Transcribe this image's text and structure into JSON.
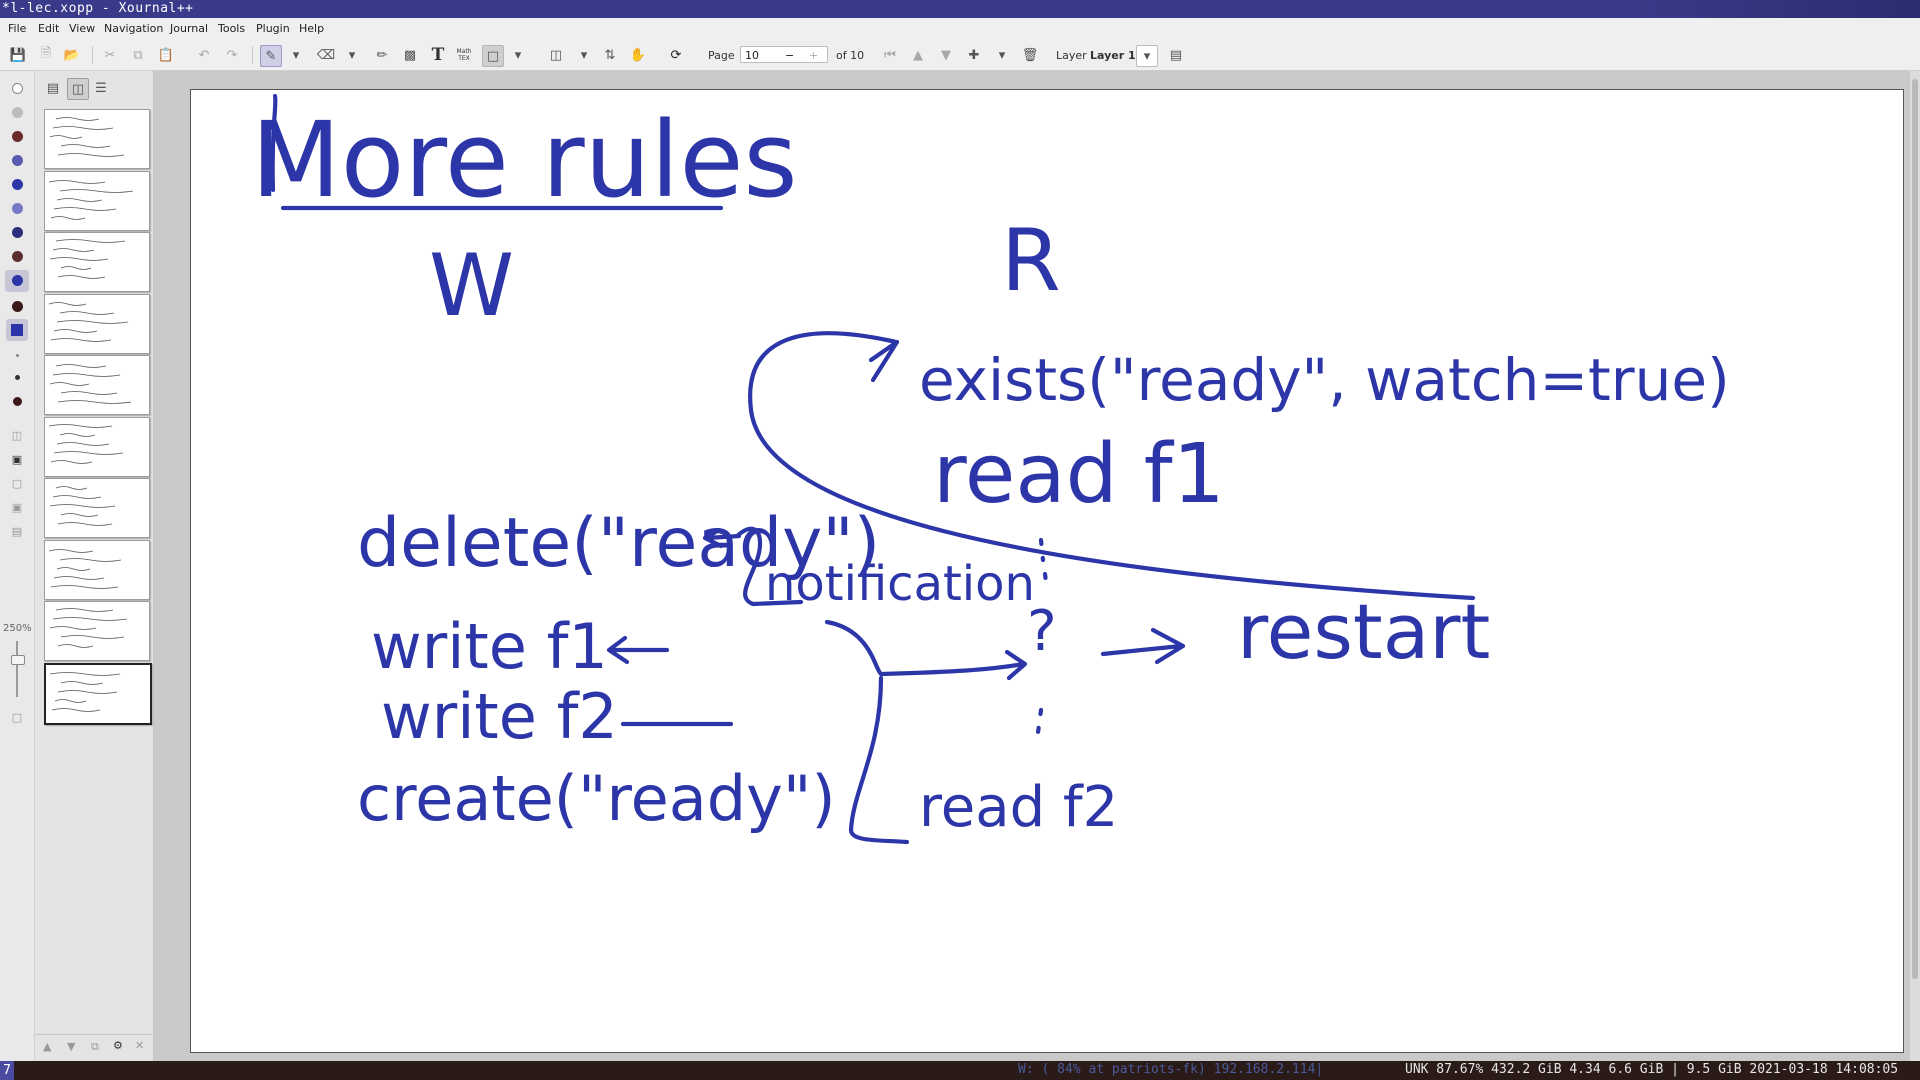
{
  "window": {
    "title": "*l-lec.xopp - Xournal++"
  },
  "menu": [
    "File",
    "Edit",
    "View",
    "Navigation",
    "Journal",
    "Tools",
    "Plugin",
    "Help"
  ],
  "toolbar": {
    "page_label": "Page",
    "page_value": "10",
    "page_of": "of 10",
    "layer_label": "Layer",
    "layer_value": "Layer 1",
    "math_label": "Math\nTEX"
  },
  "left_strip": {
    "zoom": "250%"
  },
  "sidebar": {
    "pages": 10,
    "selected_page": 10
  },
  "status": {
    "workspace": "7",
    "network": "W: ( 84% at patriots-fk) 192.168.2.114|",
    "system": "UNK 87.67% 432.2 GiB 4.34 6.6 GiB | 9.5 GiB 2021-03-18 14:08:05"
  },
  "note": {
    "title": "More rules",
    "writer_header": "W",
    "reader_header": "R",
    "writer_steps": [
      "delete(\"ready\")",
      "write f1",
      "write f2",
      "create(\"ready\")"
    ],
    "notification": "notification",
    "reader_exists": "exists(\"ready\", watch=true)",
    "reader_read1": "read f1",
    "question": "?",
    "restart": "restart",
    "reader_read2": "read f2"
  },
  "colors": {
    "ink": "#2c36a8",
    "titlebar": "#3a3a8a"
  }
}
